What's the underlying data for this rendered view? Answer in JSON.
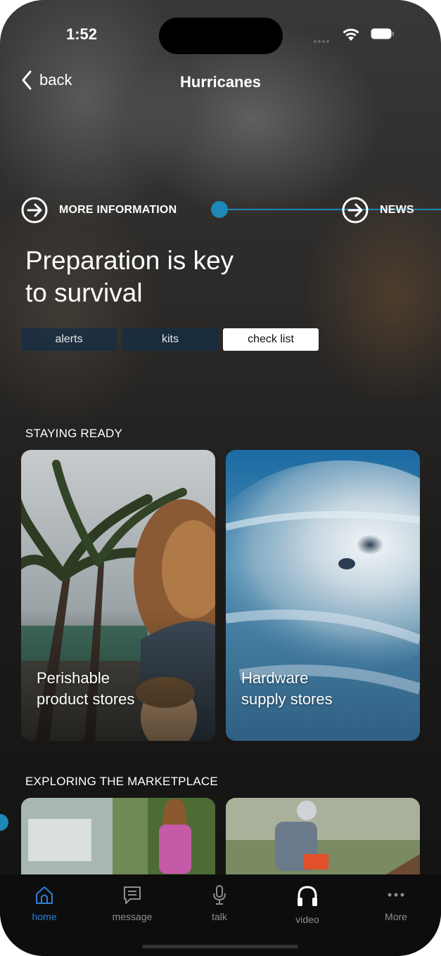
{
  "status_bar": {
    "time": "1:52"
  },
  "nav": {
    "back_label": "back",
    "title": "Hurricanes"
  },
  "links": {
    "more_info": "MORE INFORMATION",
    "news": "NEWS"
  },
  "headline": {
    "line1": "Preparation is key",
    "line2": "to survival"
  },
  "segments": [
    {
      "label": "alerts",
      "selected": false
    },
    {
      "label": "kits",
      "selected": false
    },
    {
      "label": "check list",
      "selected": true
    }
  ],
  "staying_ready": {
    "heading": "STAYING READY",
    "cards": [
      {
        "line1": "Perishable",
        "line2": "product stores"
      },
      {
        "line1": "Hardware",
        "line2": "supply stores"
      }
    ]
  },
  "marketplace": {
    "heading": "EXPLORING THE MARKETPLACE"
  },
  "tab_bar": {
    "items": [
      {
        "label": "home",
        "icon": "home-icon",
        "active": true
      },
      {
        "label": "message",
        "icon": "message-icon",
        "active": false
      },
      {
        "label": "talk",
        "icon": "microphone-icon",
        "active": false
      },
      {
        "label": "video",
        "icon": "headphones-icon",
        "active": false
      },
      {
        "label": "More",
        "icon": "more-icon",
        "active": false
      }
    ]
  },
  "colors": {
    "accent": "#1e88b7",
    "active_tab": "#2f7fd6",
    "inactive_tab": "#8e8e8e",
    "segment_bg": "#142d46"
  }
}
